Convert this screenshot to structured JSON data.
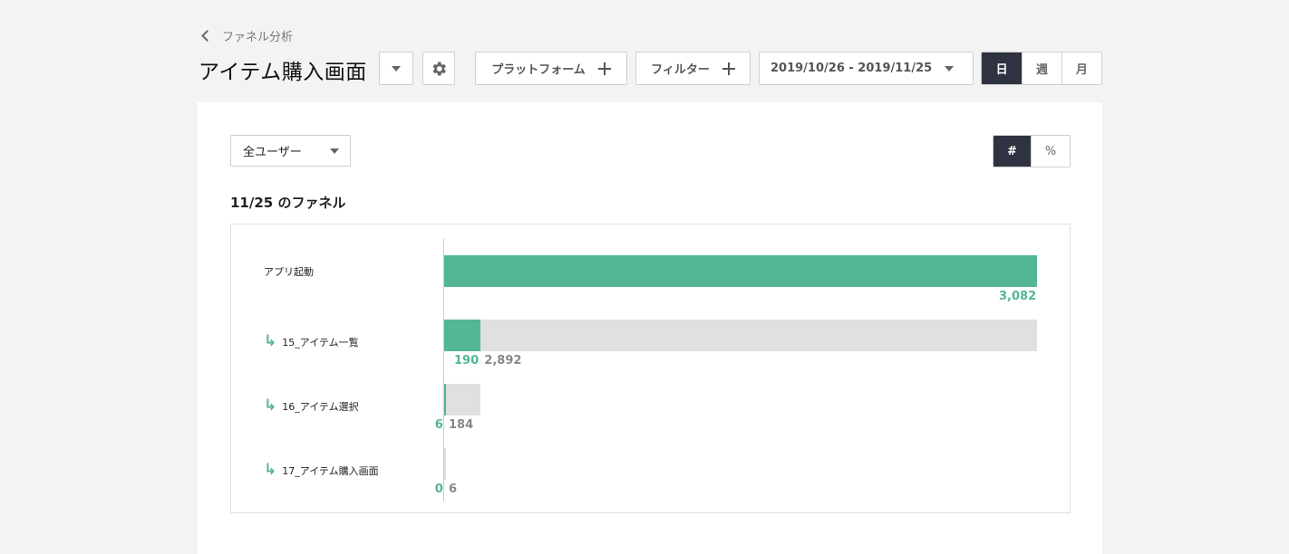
{
  "header": {
    "back_label": "ファネル分析",
    "title": "アイテム購入画面",
    "platform_label": "プラットフォーム",
    "filter_label": "フィルター",
    "date_range": "2019/10/26 - 2019/11/25",
    "granularity": [
      "日",
      "週",
      "月"
    ],
    "granularity_selected": "日"
  },
  "panel": {
    "segment_select": "全ユーザー",
    "display_modes": [
      "#",
      "%"
    ],
    "display_mode_selected": "#",
    "heading": "11/25 のファネル"
  },
  "colors": {
    "converted": "#52b697",
    "dropped": "#e0e0e0",
    "active": "#2f3240"
  },
  "chart_data": {
    "type": "bar",
    "categories": [
      "アプリ起動",
      "15_アイテム一覧",
      "16_アイテム選択",
      "17_アイテム購入画面"
    ],
    "series": [
      {
        "values": [
          3082,
          190,
          6,
          0
        ]
      },
      {
        "values": [
          0,
          2892,
          184,
          6
        ]
      }
    ],
    "converted_labels": [
      "3,082",
      "190",
      "6",
      "0"
    ],
    "dropped_labels": [
      "",
      "2,892",
      "184",
      "6"
    ],
    "xlim": [
      0,
      3082
    ]
  }
}
